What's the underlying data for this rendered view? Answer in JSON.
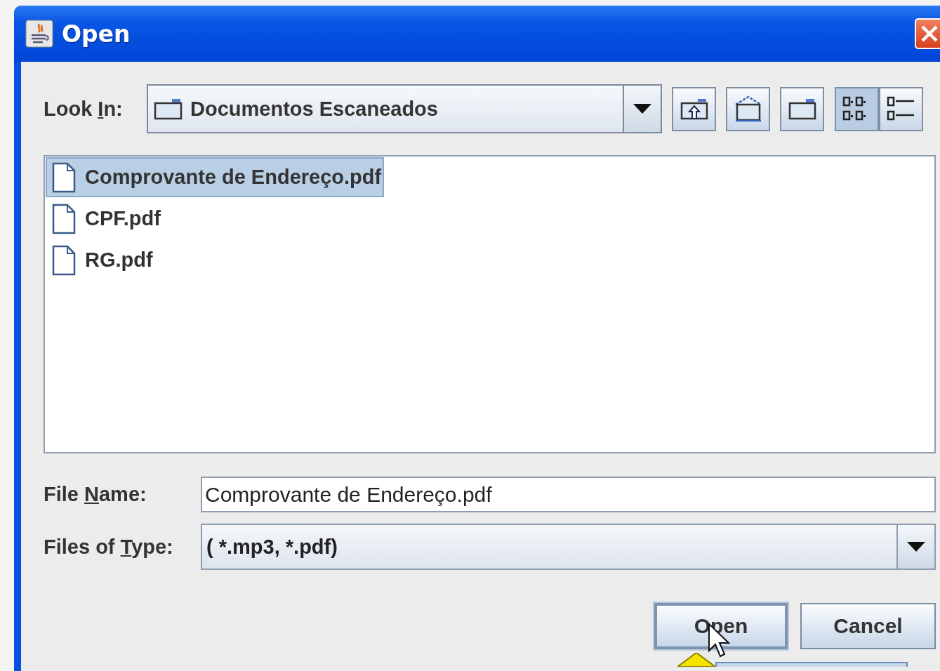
{
  "window": {
    "title": "Open"
  },
  "look_in": {
    "label": {
      "before": "Look ",
      "key": "I",
      "after": "n:"
    },
    "value": "Documentos Escaneados"
  },
  "toolbar_buttons": [
    {
      "kind": "up"
    },
    {
      "kind": "home"
    },
    {
      "kind": "new-folder"
    }
  ],
  "view_toggles": [
    {
      "kind": "list",
      "selected": true
    },
    {
      "kind": "details",
      "selected": false
    }
  ],
  "files": [
    {
      "name": "Comprovante de Endereço.pdf",
      "selected": true
    },
    {
      "name": "CPF.pdf",
      "selected": false
    },
    {
      "name": "RG.pdf",
      "selected": false
    }
  ],
  "file_name": {
    "label": {
      "before": "File ",
      "key": "N",
      "after": "ame:"
    },
    "value": "Comprovante de Endereço.pdf"
  },
  "file_type": {
    "label": {
      "before": "Files of ",
      "key": "T",
      "after": "ype:"
    },
    "value": "( *.mp3, *.pdf)"
  },
  "buttons": [
    {
      "label": "Open",
      "focused": true
    },
    {
      "label": "Cancel",
      "focused": false
    }
  ]
}
